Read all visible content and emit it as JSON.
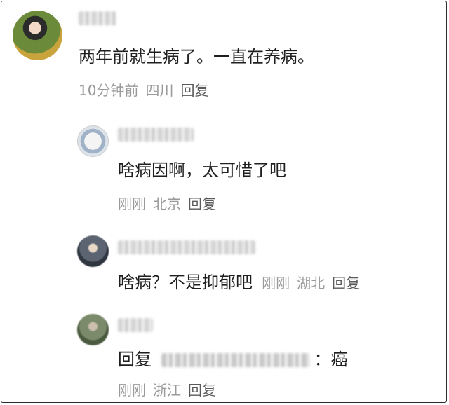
{
  "comment": {
    "text": "两年前就生病了。一直在养病。",
    "time": "10分钟前",
    "location": "四川",
    "reply_label": "回复"
  },
  "replies": [
    {
      "text": "啥病因啊，太可惜了吧",
      "time": "刚刚",
      "location": "北京",
      "reply_label": "回复"
    },
    {
      "text": "啥病？不是抑郁吧",
      "time": "刚刚",
      "location": "湖北",
      "reply_label": "回复"
    },
    {
      "reply_prefix": "回复",
      "text_suffix": "：癌",
      "time": "刚刚",
      "location": "浙江",
      "reply_label": "回复"
    }
  ]
}
